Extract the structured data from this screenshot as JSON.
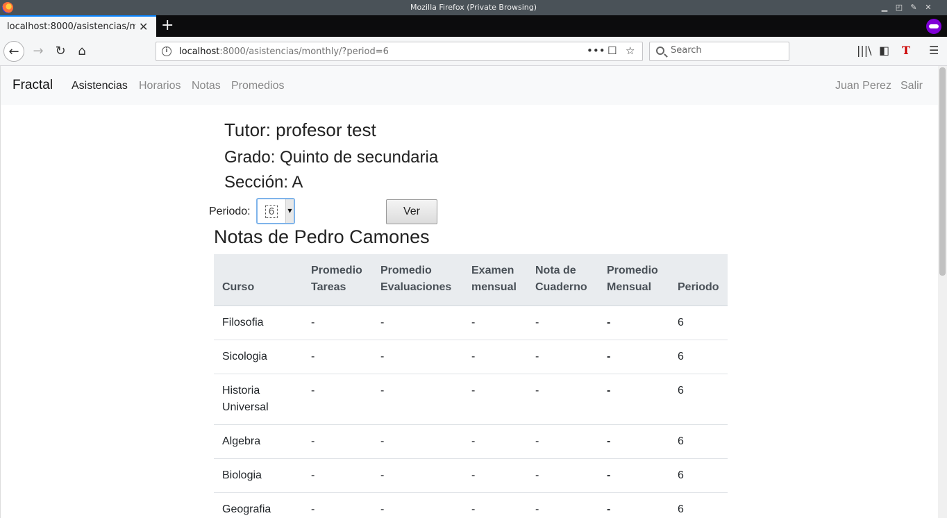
{
  "window": {
    "title": "Mozilla Firefox (Private Browsing)"
  },
  "tab": {
    "title": "localhost:8000/asistencias/m"
  },
  "urlbar": {
    "host": "localhost",
    "path": ":8000/asistencias/monthly/?period=6"
  },
  "search": {
    "placeholder": "Search"
  },
  "app": {
    "brand": "Fractal",
    "nav": [
      "Asistencias",
      "Horarios",
      "Notas",
      "Promedios"
    ],
    "user": "Juan Perez",
    "logout": "Salir"
  },
  "info": {
    "tutor": "Tutor: profesor test",
    "grado": "Grado: Quinto de secundaria",
    "seccion": "Sección: A"
  },
  "period": {
    "label": "Periodo:",
    "selected": "6",
    "button": "Ver"
  },
  "notas_title": "Notas de Pedro Camones",
  "table": {
    "headers": [
      "Curso",
      "Promedio Tareas",
      "Promedio Evaluaciones",
      "Examen mensual",
      "Nota de Cuaderno",
      "Promedio Mensual",
      "Periodo"
    ],
    "rows": [
      [
        "Filosofia",
        "-",
        "-",
        "-",
        "-",
        "-",
        "6"
      ],
      [
        "Sicologia",
        "-",
        "-",
        "-",
        "-",
        "-",
        "6"
      ],
      [
        "Historia Universal",
        "-",
        "-",
        "-",
        "-",
        "-",
        "6"
      ],
      [
        "Algebra",
        "-",
        "-",
        "-",
        "-",
        "-",
        "6"
      ],
      [
        "Biologia",
        "-",
        "-",
        "-",
        "-",
        "-",
        "6"
      ],
      [
        "Geografia",
        "-",
        "-",
        "-",
        "-",
        "-",
        "6"
      ]
    ]
  }
}
